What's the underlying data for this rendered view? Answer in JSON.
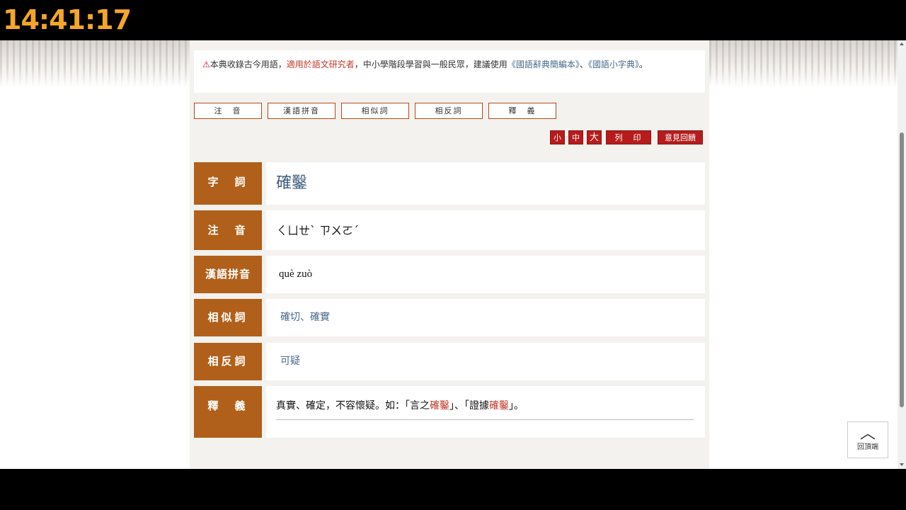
{
  "overlay": {
    "clock": "14:41:17"
  },
  "notice": {
    "icon": "warning-icon",
    "text_before": "本典收錄古今用語，",
    "text_red": "適用於語文研究者",
    "text_middle": "，中小學階段學習與一般民眾，建議使用",
    "link1": "《國語辭典簡編本》",
    "sep": "、",
    "link2": "《國語小字典》",
    "text_end": "。"
  },
  "tabs": [
    "注　音",
    "漢語拼音",
    "相似詞",
    "相反詞",
    "釋　義"
  ],
  "toolbar": {
    "size_small": "小",
    "size_medium": "中",
    "size_large": "大",
    "print": "列　印",
    "feedback": "意見回饋"
  },
  "entry": {
    "word_label": "字　詞",
    "word": "確鑿",
    "zhuyin_label": "注　音",
    "zhuyin": "ㄑㄩㄝˋ ㄗㄨㄛˊ",
    "pinyin_label": "漢語拼音",
    "pinyin": "què zuò",
    "synonyms_label": "相似詞",
    "synonyms": "確切、確實",
    "antonyms_label": "相反詞",
    "antonyms": "可疑",
    "definition_label": "釋　義",
    "definition_before": "真實、確定，不容懷疑。如：「言之",
    "definition_hl1": "確鑿",
    "definition_mid": "」、「證據",
    "definition_hl2": "確鑿",
    "definition_end": "」。"
  },
  "back_to_top": {
    "icon": "chevron-up-icon",
    "label": "回頂端"
  },
  "colors": {
    "accent_brown": "#b0601a",
    "accent_red": "#b71c1c",
    "link": "#4a6a8a"
  }
}
